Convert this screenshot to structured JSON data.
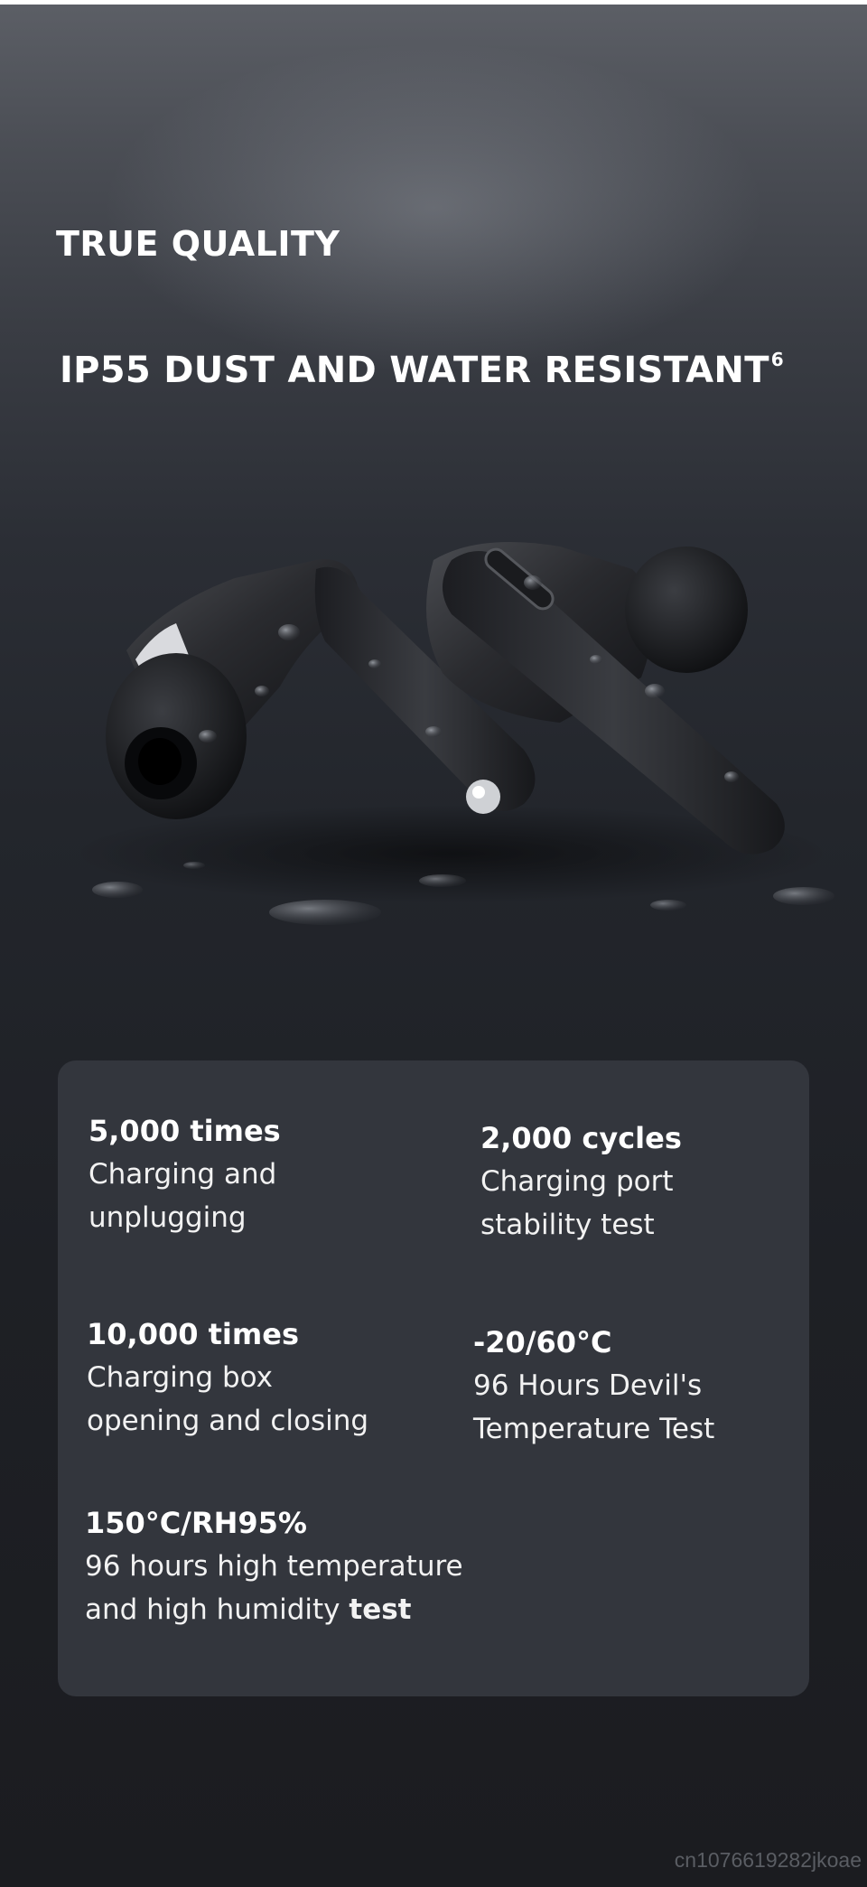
{
  "eyebrow": "TRUE QUALITY",
  "headline": {
    "text": "IP55 DUST AND WATER RESISTANT",
    "footnote": "6"
  },
  "stats": [
    {
      "value": "5,000 times",
      "desc_line1": "Charging and",
      "desc_line2": "unplugging"
    },
    {
      "value": "2,000 cycles",
      "desc_line1": "Charging port",
      "desc_line2": "stability test"
    },
    {
      "value": "10,000 times",
      "desc_line1": "Charging box",
      "desc_line2": "opening and closing"
    },
    {
      "value": "-20/60°C",
      "desc_line1": "96 Hours Devil's",
      "desc_line2": "Temperature Test"
    },
    {
      "value": "150°C/RH95%",
      "desc_line1": "96 hours high temperature",
      "desc_line2": "and high humidity ",
      "desc_line2_bold": "test"
    }
  ],
  "watermark": "cn1076619282jkoae",
  "colors": {
    "card": "#33363d",
    "background_top": "#5c5f66",
    "background_bottom": "#1b1c20",
    "text": "#ffffff"
  }
}
